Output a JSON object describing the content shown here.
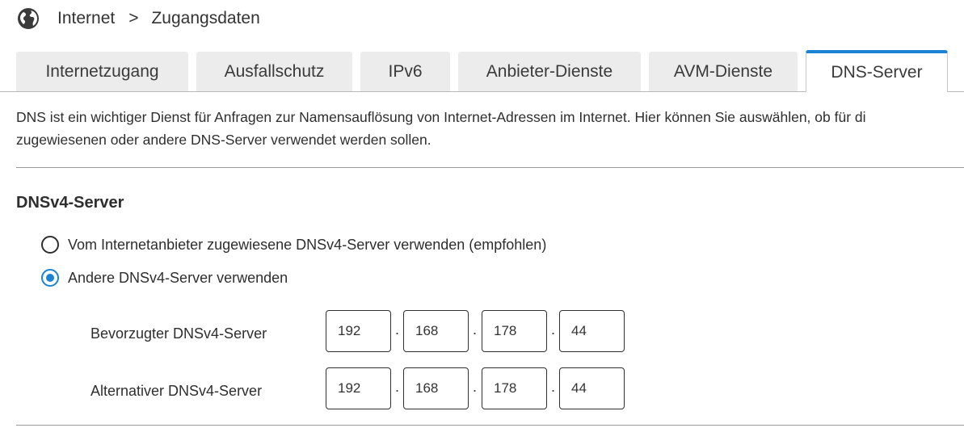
{
  "breadcrumb": {
    "icon": "globe-icon",
    "items": [
      "Internet",
      "Zugangsdaten"
    ],
    "separator": ">"
  },
  "tabs": [
    {
      "label": "Internetzugang",
      "active": false
    },
    {
      "label": "Ausfallschutz",
      "active": false
    },
    {
      "label": "IPv6",
      "active": false
    },
    {
      "label": "Anbieter-Dienste",
      "active": false
    },
    {
      "label": "AVM-Dienste",
      "active": false
    },
    {
      "label": "DNS-Server",
      "active": true
    }
  ],
  "intro": {
    "line1": "DNS ist ein wichtiger Dienst für Anfragen zur Namensauflösung von Internet-Adressen im Internet. Hier können Sie auswählen, ob für di",
    "line2": "zugewiesenen oder andere DNS-Server verwendet werden sollen."
  },
  "dnsv4": {
    "title": "DNSv4-Server",
    "options": [
      {
        "label": "Vom Internetanbieter zugewiesene DNSv4-Server verwenden (empfohlen)",
        "checked": false
      },
      {
        "label": "Andere DNSv4-Server verwenden",
        "checked": true
      }
    ],
    "preferred": {
      "label": "Bevorzugter DNSv4-Server",
      "octets": [
        "192",
        "168",
        "178",
        "44"
      ]
    },
    "alternative": {
      "label": "Alternativer DNSv4-Server",
      "octets": [
        "192",
        "168",
        "178",
        "44"
      ]
    },
    "octet_separator": "."
  },
  "colors": {
    "accent": "#1a83d6",
    "tab_inactive": "#ececec",
    "text": "#2e2e2e"
  }
}
